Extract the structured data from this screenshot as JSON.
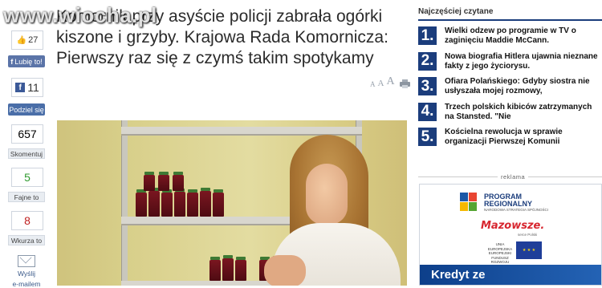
{
  "watermark": "www.wiocha.pl",
  "social": {
    "like_count": "27",
    "like_button": "Lubię to!",
    "fb_count": "11",
    "share_button": "Podziel się",
    "comments_count": "657",
    "comments_label": "Skomentuj",
    "cool_count": "5",
    "cool_label": "Fajne to",
    "annoyed_count": "8",
    "annoyed_label": "Wkurza to",
    "email_label_1": "Wyślij",
    "email_label_2": "e-mailem"
  },
  "article": {
    "title": "Komornik przy asyście policji zabrała ogórki kiszone i grzyby. Krajowa Rada Komornicza: Pierwszy raz się z czymś takim spotykamy",
    "font_small": "A",
    "font_medium": "A",
    "font_large": "A"
  },
  "sidebar": {
    "header": "Najczęściej czytane",
    "items": [
      {
        "num": "1.",
        "text": "Wielki odzew po programie w TV o zaginięciu Maddie McCann."
      },
      {
        "num": "2.",
        "text": "Nowa biografia Hitlera ujawnia nieznane fakty z jego życiorysu."
      },
      {
        "num": "3.",
        "text": "Ofiara Polańskiego: Gdyby siostra nie usłyszała mojej rozmowy,"
      },
      {
        "num": "4.",
        "text": "Trzech polskich kibiców zatrzymanych na Stansted. \"Nie"
      },
      {
        "num": "5.",
        "text": "Kościelna rewolucja w sprawie organizacji Pierwszej Komunii"
      }
    ],
    "ad_label": "reklama",
    "ad": {
      "program_line1": "PROGRAM",
      "program_line2": "REGIONALNY",
      "program_sub": "NARODOWA STRATEGIA SPÓJNOŚCI",
      "mazowsze": "Mazowsze.",
      "mazowsze_sub": "serce Polski",
      "eu_text": "UNIA EUROPEJSKA EUROPEJSKI FUNDUSZ ROZWOJU REGIONALNEGO",
      "bottom_text": "Kredyt ze"
    }
  },
  "colors": {
    "nav_blue": "#1b3d7c",
    "facebook": "#3b5998",
    "positive": "#2f9a2f",
    "negative": "#c02020"
  }
}
